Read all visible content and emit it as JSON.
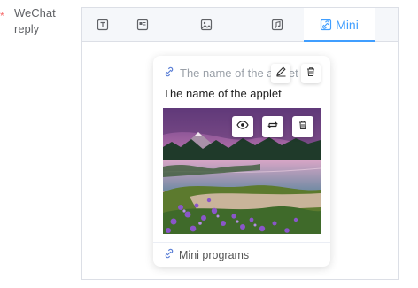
{
  "form": {
    "required_mark": "*",
    "label": "WeChat reply"
  },
  "tabs": [
    {
      "icon": "text-icon",
      "label": ""
    },
    {
      "icon": "image-text-icon",
      "label": ""
    },
    {
      "icon": "image-icon",
      "label": ""
    },
    {
      "icon": "music-icon",
      "label": ""
    },
    {
      "icon": "link-icon",
      "label": "Mini"
    }
  ],
  "active_tab": "Mini",
  "card": {
    "header_text": "The name of the applet",
    "title": "The name of the applet",
    "footer": "Mini programs"
  },
  "colors": {
    "accent": "#409eff",
    "required": "#f56c6c",
    "border": "#dcdfe6"
  }
}
